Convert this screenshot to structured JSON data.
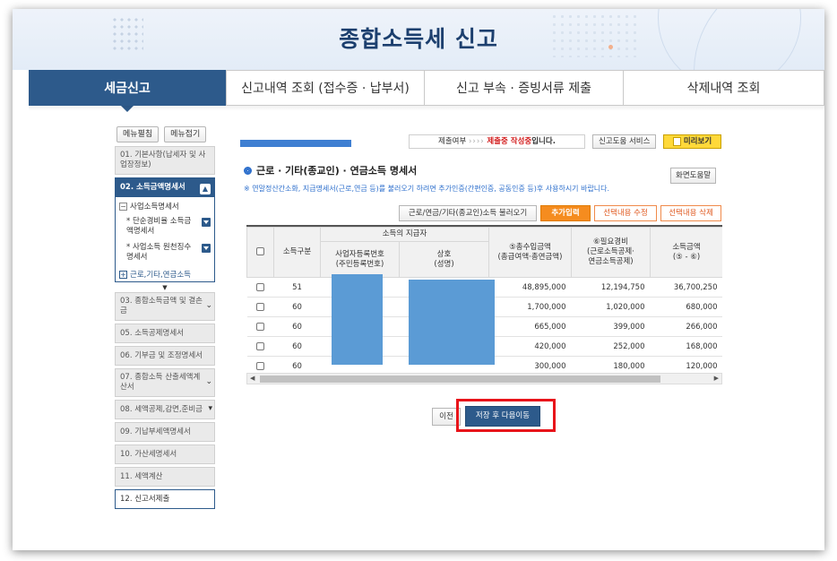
{
  "banner": {
    "title": "종합소득세 신고"
  },
  "tabs": [
    {
      "label": "세금신고",
      "active": true
    },
    {
      "label": "신고내역 조회 (접수증 · 납부서)",
      "active": false
    },
    {
      "label": "신고 부속 · 증빙서류 제출",
      "active": false
    },
    {
      "label": "삭제내역 조회",
      "active": false
    }
  ],
  "menu_buttons": {
    "expand": "메뉴펼침",
    "collapse": "메뉴접기"
  },
  "sidebar": {
    "item01": "01. 기본사항(납세자 및 사업장정보)",
    "item02": "02. 소득금액명세서",
    "sub_title": "사업소득명세서",
    "sub_entry1": "* 단순경비율 소득금액명세서",
    "sub_entry2": "* 사업소득 원천징수명세서",
    "sub_footer": "근로,기타,연금소득",
    "item03": "03. 종합소득금액 및 결손금",
    "item05": "05. 소득공제명세서",
    "item06": "06. 기부금 및 조정명세서",
    "item07": "07. 종합소득 산출세액계산서",
    "item08": "08. 세액공제,감면,준비금",
    "item09": "09. 기납부세액명세서",
    "item10": "10. 가산세명세서",
    "item11": "11. 세액계산",
    "item12": "12. 신고서제출"
  },
  "status": {
    "prefix": "제출여부",
    "arrows": "››››",
    "state": "제출중 작성중",
    "suffix": "입니다."
  },
  "service_button": "신고도움 서비스",
  "preview_button": "미리보기",
  "section": {
    "title": "근로 · 기타(종교인) · 연금소득 명세서",
    "help_button": "화면도움말",
    "notice": "※ 연말정산간소화, 지급명세서(근로,연금 등)를 불러오기 하려면 추가인증(간편인증, 공동인증 등)후 사용하시기 바랍니다."
  },
  "actions": {
    "load": "근로/연금/기타(종교인)소득 불러오기",
    "add": "추가입력",
    "edit": "선택내용 수정",
    "delete": "선택내용 삭제"
  },
  "table": {
    "headers": {
      "type": "소득구분",
      "payer_group": "소득의 지급자",
      "biz_no": "사업자등록번호\n(주민등록번호)",
      "name": "상호\n(성명)",
      "gross": "⑤총수입금액\n(총급여액·총연금액)",
      "expense": "⑥필요경비\n(근로소득공제·\n연금소득공제)",
      "income": "소득금액\n(⑤ - ⑥)"
    },
    "rows": [
      {
        "type": "51",
        "gross": "48,895,000",
        "expense": "12,194,750",
        "income": "36,700,250"
      },
      {
        "type": "60",
        "gross": "1,700,000",
        "expense": "1,020,000",
        "income": "680,000"
      },
      {
        "type": "60",
        "gross": "665,000",
        "expense": "399,000",
        "income": "266,000"
      },
      {
        "type": "60",
        "gross": "420,000",
        "expense": "252,000",
        "income": "168,000"
      },
      {
        "type": "60",
        "gross": "300,000",
        "expense": "180,000",
        "income": "120,000"
      }
    ]
  },
  "nav": {
    "prev": "이전",
    "next": "저장 후 다음이동"
  },
  "colors": {
    "primary": "#2d5a8b",
    "accent_orange": "#f58c1f",
    "highlight_red": "#e8141a",
    "mask_blue": "#5b9bd5"
  }
}
